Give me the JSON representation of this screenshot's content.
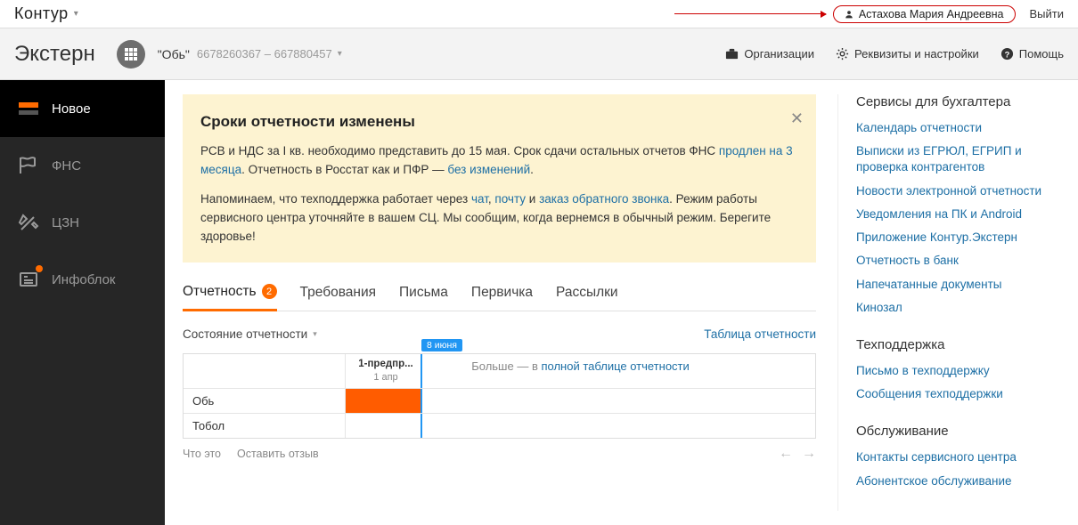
{
  "topbar": {
    "brand": "Контур",
    "user_name": "Астахова Мария Андреевна",
    "logout": "Выйти"
  },
  "header": {
    "product": "Экстерн",
    "org_name": "\"Обь\"",
    "org_ids": "6678260367 – 667880457",
    "organizations": "Организации",
    "settings": "Реквизиты и настройки",
    "help": "Помощь"
  },
  "sidebar": {
    "items": [
      {
        "label": "Новое"
      },
      {
        "label": "ФНС"
      },
      {
        "label": "ЦЗН"
      },
      {
        "label": "Инфоблок"
      }
    ]
  },
  "alert": {
    "title": "Сроки отчетности изменены",
    "p1_a": "РСВ и НДС за I кв. необходимо представить до 15 мая. Срок сдачи остальных отчетов ФНС ",
    "p1_link1": "продлен на 3 месяца",
    "p1_b": ". Отчетность в Росстат как и ПФР — ",
    "p1_link2": "без изменений",
    "p1_c": ".",
    "p2_a": "Напоминаем, что техподдержка работает через ",
    "p2_link1": "чат",
    "p2_b": ", ",
    "p2_link2": "почту",
    "p2_c": " и ",
    "p2_link3": "заказ обратного звонка",
    "p2_d": ". Режим работы сервисного центра уточняйте в вашем СЦ. Мы сообщим, когда вернемся в обычный режим. Берегите здоровье!"
  },
  "tabs": [
    {
      "label": "Отчетность",
      "badge": "2"
    },
    {
      "label": "Требования"
    },
    {
      "label": "Письма"
    },
    {
      "label": "Первичка"
    },
    {
      "label": "Рассылки"
    }
  ],
  "filter": {
    "label": "Состояние отчетности",
    "table_link": "Таблица отчетности"
  },
  "timeline": {
    "flag_date": "8 июня",
    "col_title": "1-предпр...",
    "col_sub": "1 апр",
    "more_text": "Больше — в ",
    "more_link": "полной таблице отчетности",
    "rows": [
      "Обь",
      "Тобол"
    ],
    "footer_what": "Что это",
    "footer_feedback": "Оставить отзыв"
  },
  "right": {
    "groups": [
      {
        "title": "Сервисы для бухгалтера",
        "links": [
          "Календарь отчетности",
          "Выписки из ЕГРЮЛ, ЕГРИП и проверка контрагентов",
          "Новости электронной отчетности",
          "Уведомления на ПК и Android",
          "Приложение Контур.Экстерн",
          "Отчетность в банк",
          "Напечатанные документы",
          "Кинозал"
        ]
      },
      {
        "title": "Техподдержка",
        "links": [
          "Письмо в техподдержку",
          "Сообщения техподдержки"
        ]
      },
      {
        "title": "Обслуживание",
        "links": [
          "Контакты сервисного центра",
          "Абонентское обслуживание"
        ]
      }
    ]
  }
}
